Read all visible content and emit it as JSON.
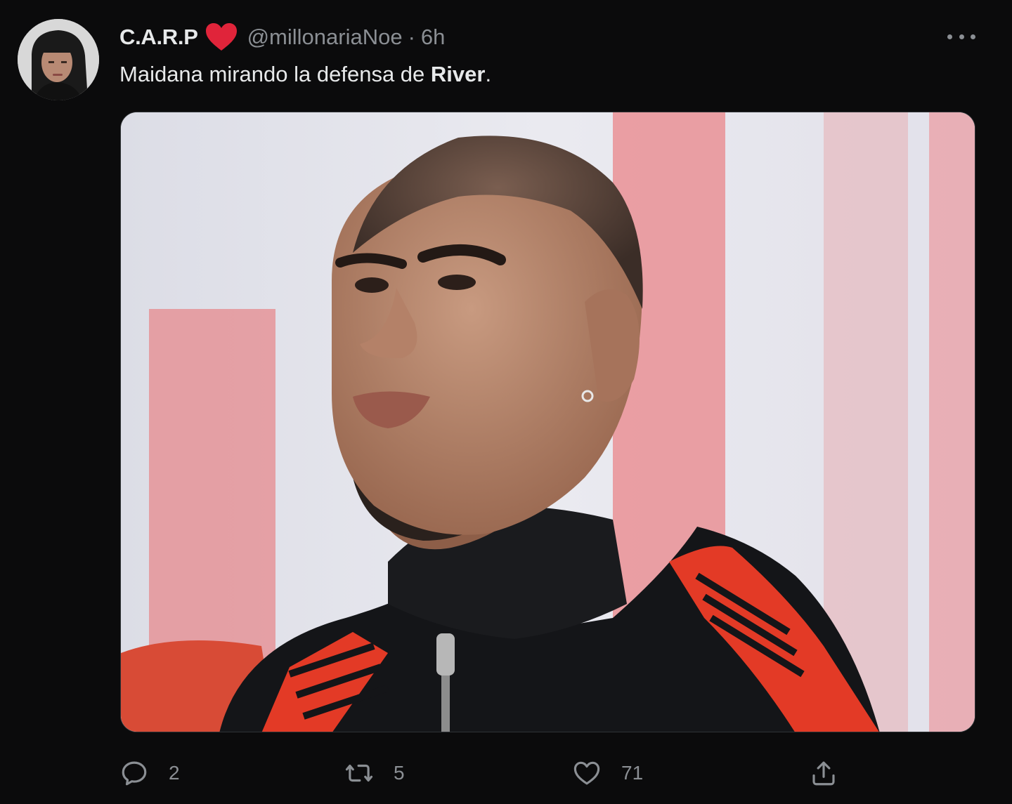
{
  "tweet": {
    "display_name": "C.A.R.P",
    "name_emoji": "heart-icon",
    "handle": "@millonariaNoe",
    "separator": "·",
    "time": "6h",
    "text_before": "Maidana mirando la defensa de ",
    "text_bold": "River",
    "text_after": ".",
    "media_alt": "photo"
  },
  "actions": {
    "reply_count": "2",
    "retweet_count": "5",
    "like_count": "71"
  },
  "colors": {
    "background": "#0b0b0c",
    "text": "#e7e9ea",
    "muted": "#8b8f94",
    "heart": "#e0243a"
  }
}
